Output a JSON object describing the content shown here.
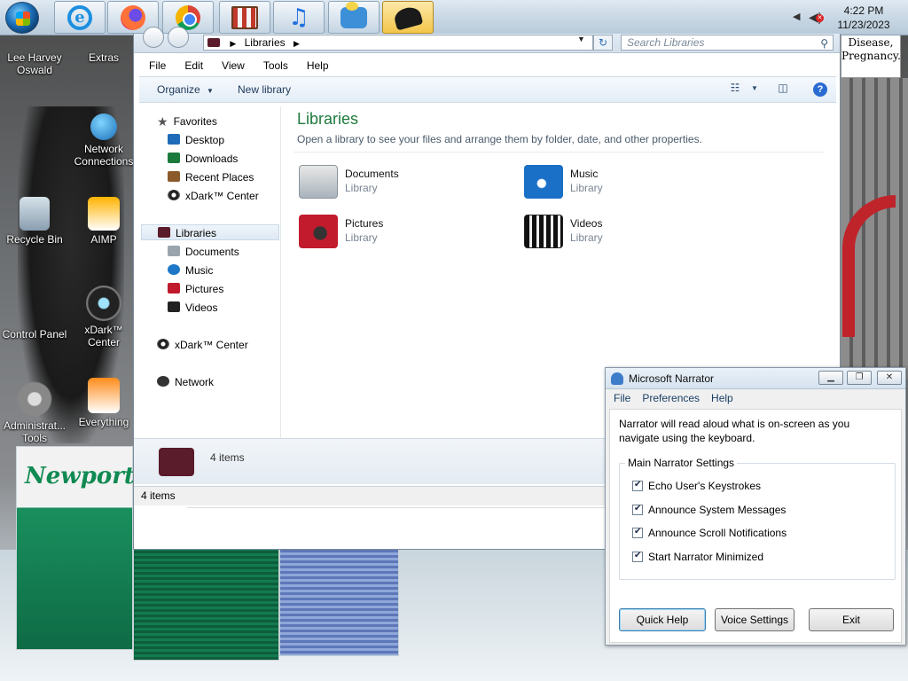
{
  "taskbar": {
    "apps": [
      {
        "name": "internet-explorer-icon",
        "active": false
      },
      {
        "name": "firefox-icon",
        "active": false
      },
      {
        "name": "chrome-icon",
        "active": false
      },
      {
        "name": "store-icon",
        "active": false
      },
      {
        "name": "itunes-icon",
        "active": false
      },
      {
        "name": "messenger-icon",
        "active": false
      },
      {
        "name": "hat-icon",
        "active": true
      }
    ],
    "clock": {
      "time": "4:22 PM",
      "date": "11/23/2023"
    }
  },
  "desktop": {
    "icons": [
      {
        "label": "Lee Harvey Oswald"
      },
      {
        "label": "Extras"
      },
      {
        "label": "Network Connections"
      },
      {
        "label": "Recycle Bin"
      },
      {
        "label": "AIMP"
      },
      {
        "label": "Control Panel"
      },
      {
        "label": "xDark™ Center"
      },
      {
        "label": "Administrat... Tools"
      },
      {
        "label": "Everything"
      }
    ],
    "background_text": {
      "sign": "Disease, Pregnancy.",
      "pack_brand": "Newport"
    }
  },
  "explorer": {
    "address": "Libraries",
    "search_placeholder": "Search Libraries",
    "menu": [
      "File",
      "Edit",
      "View",
      "Tools",
      "Help"
    ],
    "toolbar": {
      "organize": "Organize",
      "new_library": "New library"
    },
    "nav": {
      "favorites": "Favorites",
      "desktop": "Desktop",
      "downloads": "Downloads",
      "recent_places": "Recent Places",
      "xdark_fav": "xDark™ Center",
      "libraries": "Libraries",
      "documents": "Documents",
      "music": "Music",
      "pictures": "Pictures",
      "videos": "Videos",
      "xdark": "xDark™ Center",
      "network": "Network"
    },
    "heading": "Libraries",
    "subheading": "Open a library to see your files and arrange them by folder, date, and other properties.",
    "libraries": [
      {
        "name": "Documents",
        "type": "Library"
      },
      {
        "name": "Music",
        "type": "Library"
      },
      {
        "name": "Pictures",
        "type": "Library"
      },
      {
        "name": "Videos",
        "type": "Library"
      }
    ],
    "details_count": "4 items",
    "status_count": "4 items"
  },
  "narrator": {
    "title": "Microsoft Narrator",
    "menu": [
      "File",
      "Preferences",
      "Help"
    ],
    "description": "Narrator will read aloud what is on-screen as you navigate using the keyboard.",
    "group_label": "Main Narrator Settings",
    "options": [
      {
        "label": "Echo User's Keystrokes",
        "checked": true
      },
      {
        "label": "Announce System Messages",
        "checked": true
      },
      {
        "label": "Announce Scroll Notifications",
        "checked": true
      },
      {
        "label": "Start Narrator Minimized",
        "checked": true
      }
    ],
    "buttons": {
      "quick_help": "Quick Help",
      "voice_settings": "Voice Settings",
      "exit": "Exit"
    }
  }
}
